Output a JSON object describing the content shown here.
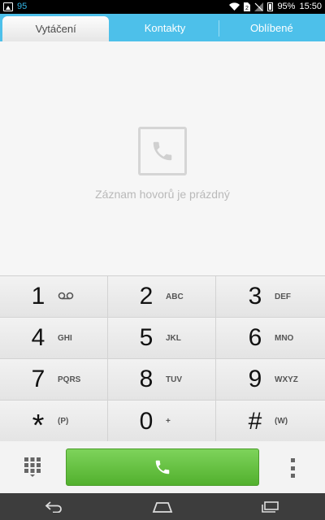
{
  "status_bar": {
    "notification_count": "95",
    "battery_percent": "95%",
    "time": "15:50",
    "icons": [
      "image-icon",
      "wifi-icon",
      "sim-icon",
      "signal-icon",
      "battery-icon"
    ]
  },
  "tabs": [
    {
      "label": "Vytáčení",
      "active": true
    },
    {
      "label": "Kontakty",
      "active": false
    },
    {
      "label": "Oblíbené",
      "active": false
    }
  ],
  "empty_state": {
    "icon": "phone-icon",
    "message": "Záznam hovorů je prázdný"
  },
  "dialpad": {
    "keys": [
      {
        "digit": "1",
        "sub": "",
        "sub_icon": "voicemail-icon"
      },
      {
        "digit": "2",
        "sub": "ABC"
      },
      {
        "digit": "3",
        "sub": "DEF"
      },
      {
        "digit": "4",
        "sub": "GHI"
      },
      {
        "digit": "5",
        "sub": "JKL"
      },
      {
        "digit": "6",
        "sub": "MNO"
      },
      {
        "digit": "7",
        "sub": "PQRS"
      },
      {
        "digit": "8",
        "sub": "TUV"
      },
      {
        "digit": "9",
        "sub": "WXYZ"
      },
      {
        "digit": "*",
        "sub": "(P)"
      },
      {
        "digit": "0",
        "sub": "+"
      },
      {
        "digit": "#",
        "sub": "(W)"
      }
    ]
  },
  "action_bar": {
    "left_icon": "dialpad-grid-icon",
    "call_icon": "phone-icon",
    "right_icon": "more-vert-icon"
  },
  "nav_bar": {
    "buttons": [
      "back-icon",
      "home-icon",
      "recents-icon"
    ]
  },
  "colors": {
    "accent": "#4dc0ea",
    "call_green": "#5bb835",
    "status_blue": "#33b5e5"
  }
}
